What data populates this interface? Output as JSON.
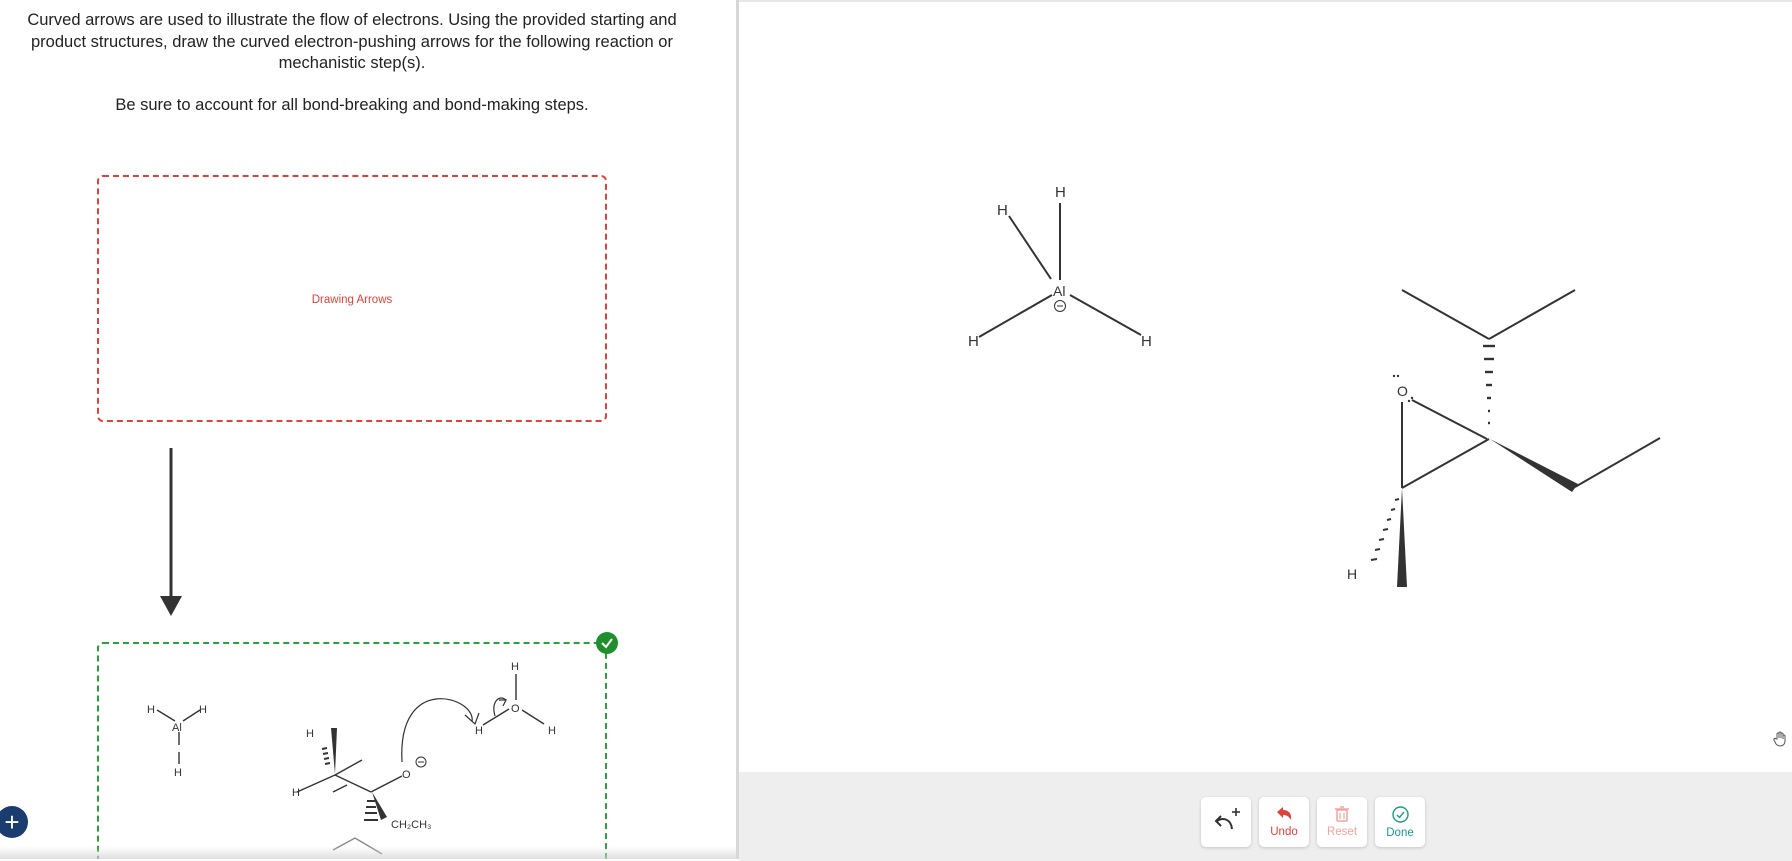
{
  "instructions": {
    "paragraph1": "Curved arrows are used to illustrate the flow of electrons. Using the provided starting and product structures, draw the curved electron-pushing arrows for the following reaction or mechanistic step(s).",
    "paragraph2": "Be sure to account for all bond-breaking and bond-making steps."
  },
  "drop_zone": {
    "label": "Drawing Arrows"
  },
  "product_box": {
    "labels": {
      "h": "H",
      "al": "Al",
      "o": "O",
      "ethyl": "CH₂CH₃"
    }
  },
  "canvas": {
    "atoms": {
      "h": "H",
      "al": "Al",
      "o": "O"
    }
  },
  "toolbar": {
    "undo_label": "Undo",
    "reset_label": "Reset",
    "done_label": "Done"
  },
  "colors": {
    "accent_red": "#e0413a",
    "accent_green": "#2aa23a",
    "done_teal": "#1d9a8a",
    "add_button_navy": "#1b3c6e"
  }
}
